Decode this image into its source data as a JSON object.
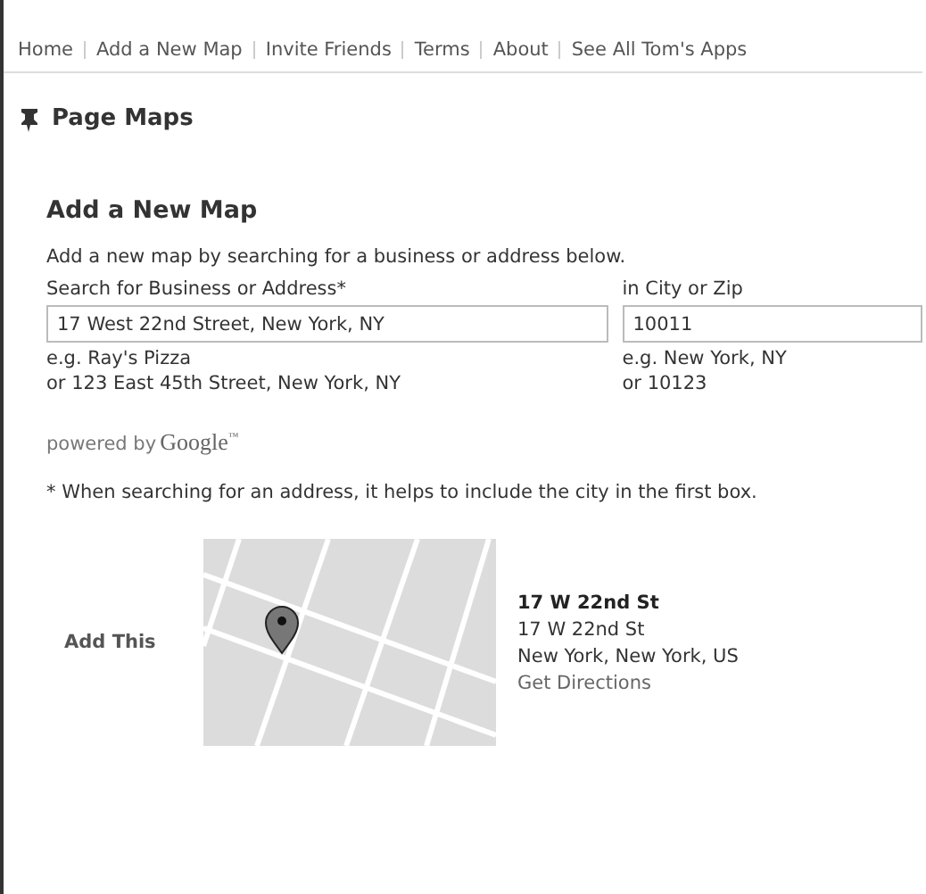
{
  "nav": [
    "Home",
    "Add a New Map",
    "Invite Friends",
    "Terms",
    "About",
    "See All Tom's Apps"
  ],
  "app_title": "Page Maps",
  "heading": "Add a New Map",
  "intro": "Add a new map by searching for a business or address below.",
  "fields": [
    {
      "label": "Search for Business or Address*",
      "value": "17 West 22nd Street, New York, NY",
      "hints": [
        "e.g. Ray's Pizza",
        "or 123 East 45th Street, New York, NY"
      ]
    },
    {
      "label": "in City or Zip",
      "value": "10011",
      "hints": [
        "e.g. New York, NY",
        "or 10123"
      ]
    }
  ],
  "powered_by": "powered by",
  "brand": "Google",
  "brand_mark": "™",
  "note": "* When searching for an address, it helps to include the city in the first box.",
  "result": {
    "action": "Add This",
    "name": "17 W 22nd St",
    "street": "17 W 22nd St",
    "city": "New York, New York, US",
    "link": "Get Directions"
  }
}
